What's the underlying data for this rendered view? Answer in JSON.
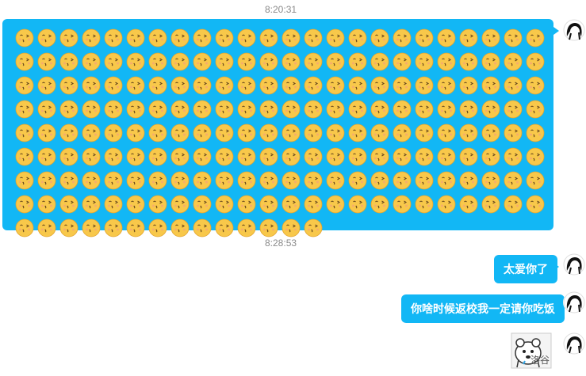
{
  "chat": {
    "messages": [
      {
        "timestamp": "8:20:31",
        "type": "emoji-burst",
        "emoji_count": 206,
        "emoji": "kissing-face-emoji"
      },
      {
        "timestamp": "8:28:53",
        "type": "text",
        "text": "太爱你了"
      },
      {
        "type": "text",
        "text": "你啥时候返校我一定请你吃饭"
      },
      {
        "type": "sticker",
        "sticker_caption": "洛谷",
        "sticker": "cartoon-animal-sticker"
      }
    ]
  },
  "colors": {
    "bubble": "#12b7f5",
    "timestamp": "#8a8a8a"
  }
}
